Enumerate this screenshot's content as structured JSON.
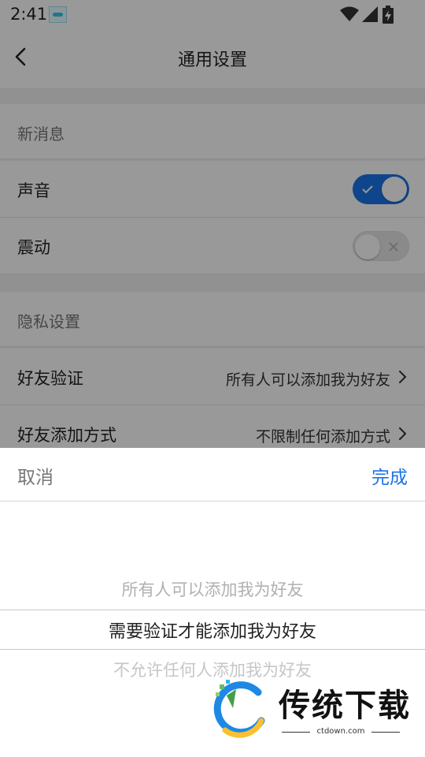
{
  "status_bar": {
    "time": "2:41",
    "icons": [
      "app-notification-icon",
      "wifi-icon",
      "signal-icon",
      "battery-charging-icon"
    ]
  },
  "nav": {
    "title": "通用设置",
    "back_icon": "chevron-left-icon"
  },
  "sections": {
    "new_message": {
      "header": "新消息",
      "sound_label": "声音",
      "sound_on": true,
      "vibrate_label": "震动",
      "vibrate_on": false
    },
    "privacy": {
      "header": "隐私设置",
      "friend_verify_label": "好友验证",
      "friend_verify_value": "所有人可以添加我为好友",
      "friend_add_label": "好友添加方式",
      "friend_add_value": "不限制任何添加方式"
    }
  },
  "picker": {
    "cancel_label": "取消",
    "done_label": "完成",
    "options": [
      "所有人可以添加我为好友",
      "需要验证才能添加我为好友",
      "不允许任何人添加我为好友"
    ],
    "selected_index": 1
  },
  "watermark": {
    "name": "传统下载",
    "site": "ctdown.com"
  },
  "colors": {
    "accent": "#1a73e8",
    "background": "#f2f2f2",
    "overlay": "rgba(0,0,0,0.40)"
  }
}
